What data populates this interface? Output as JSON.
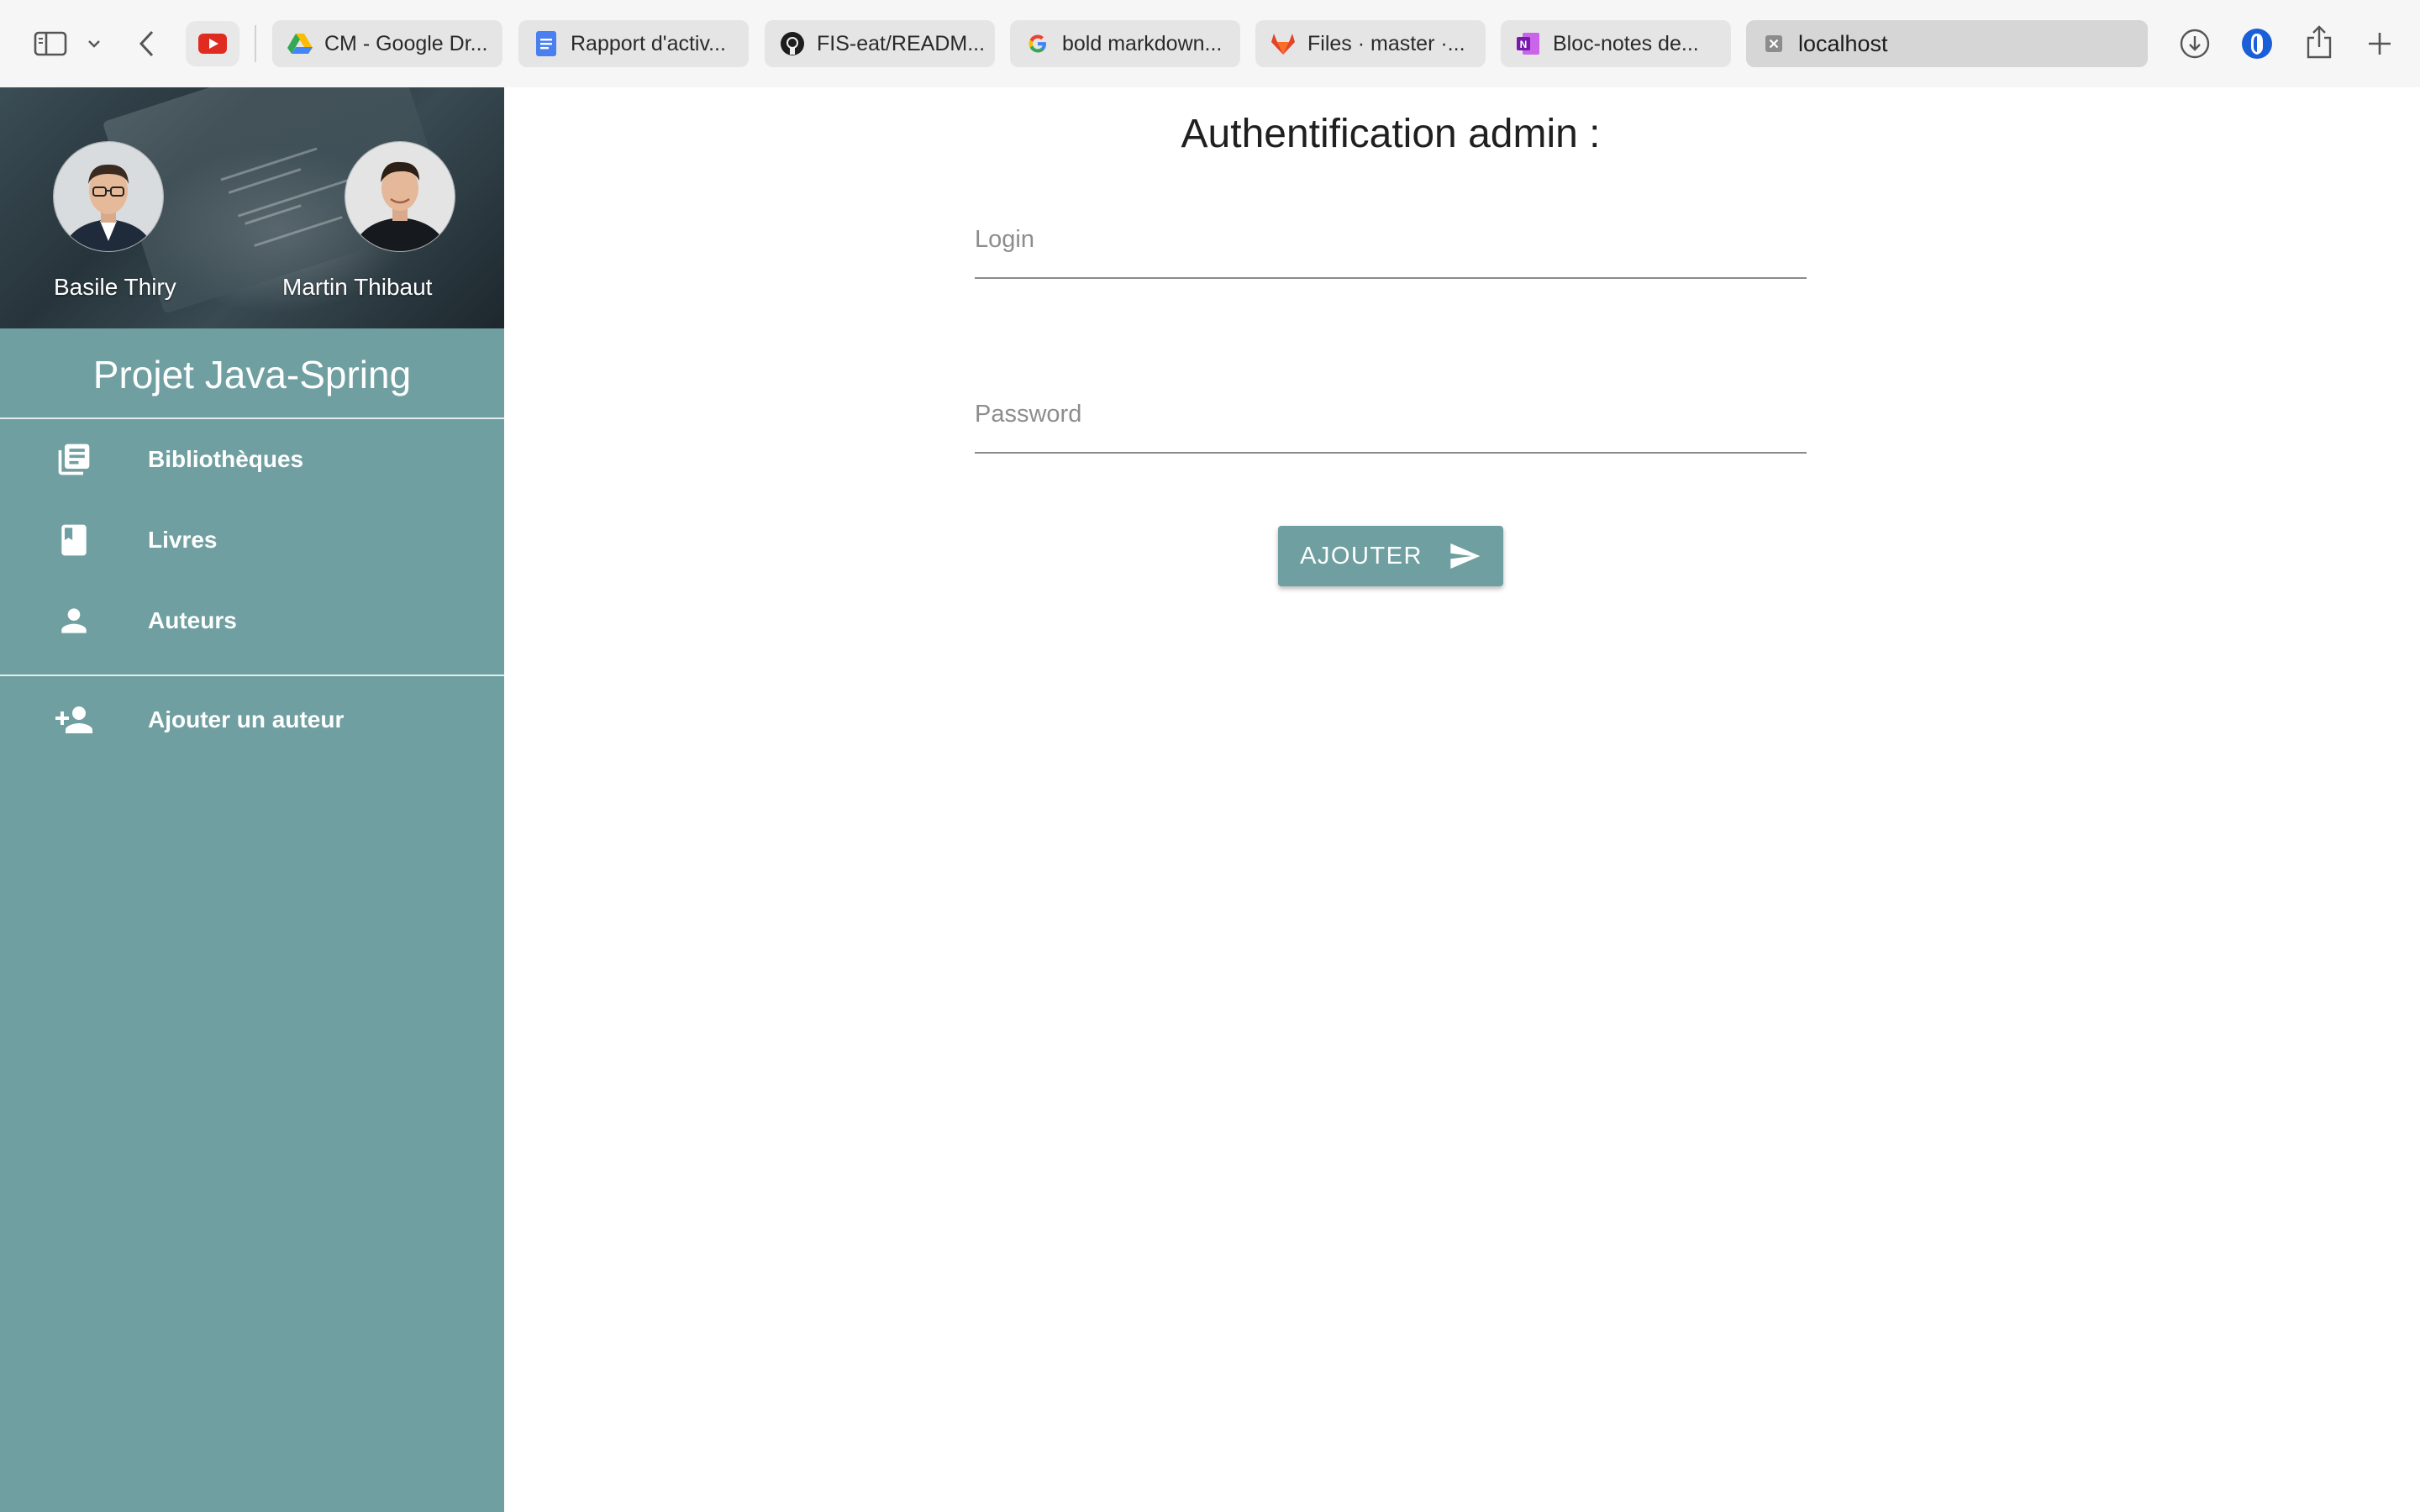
{
  "browser": {
    "tabs": [
      {
        "label": "CM - Google Dr...",
        "icon": "google-drive-icon"
      },
      {
        "label": "Rapport d'activ...",
        "icon": "google-docs-icon"
      },
      {
        "label": "FIS-eat/READM...",
        "icon": "github-icon"
      },
      {
        "label": "bold markdown...",
        "icon": "google-icon"
      },
      {
        "label": "Files · master ·...",
        "icon": "gitlab-icon"
      },
      {
        "label": "Bloc-notes de...",
        "icon": "onenote-icon"
      }
    ],
    "active_tab": {
      "label": "localhost",
      "icon": "close-icon"
    }
  },
  "sidebar": {
    "people": [
      {
        "name": "Basile Thiry"
      },
      {
        "name": "Martin Thibaut"
      }
    ],
    "project_title": "Projet Java-Spring",
    "nav": [
      {
        "label": "Bibliothèques",
        "icon": "library-books-icon"
      },
      {
        "label": "Livres",
        "icon": "book-icon"
      },
      {
        "label": "Auteurs",
        "icon": "person-icon"
      }
    ],
    "actions": [
      {
        "label": "Ajouter un auteur",
        "icon": "person-add-icon"
      }
    ]
  },
  "main": {
    "title": "Authentification admin :",
    "login": {
      "placeholder": "Login",
      "value": ""
    },
    "password": {
      "placeholder": "Password",
      "value": ""
    },
    "submit": {
      "label": "AJOUTER",
      "icon": "send-icon"
    }
  },
  "colors": {
    "accent": "#6f9fa0",
    "sidebar_text": "#ffffff",
    "input_underline": "#8a8a8a"
  }
}
